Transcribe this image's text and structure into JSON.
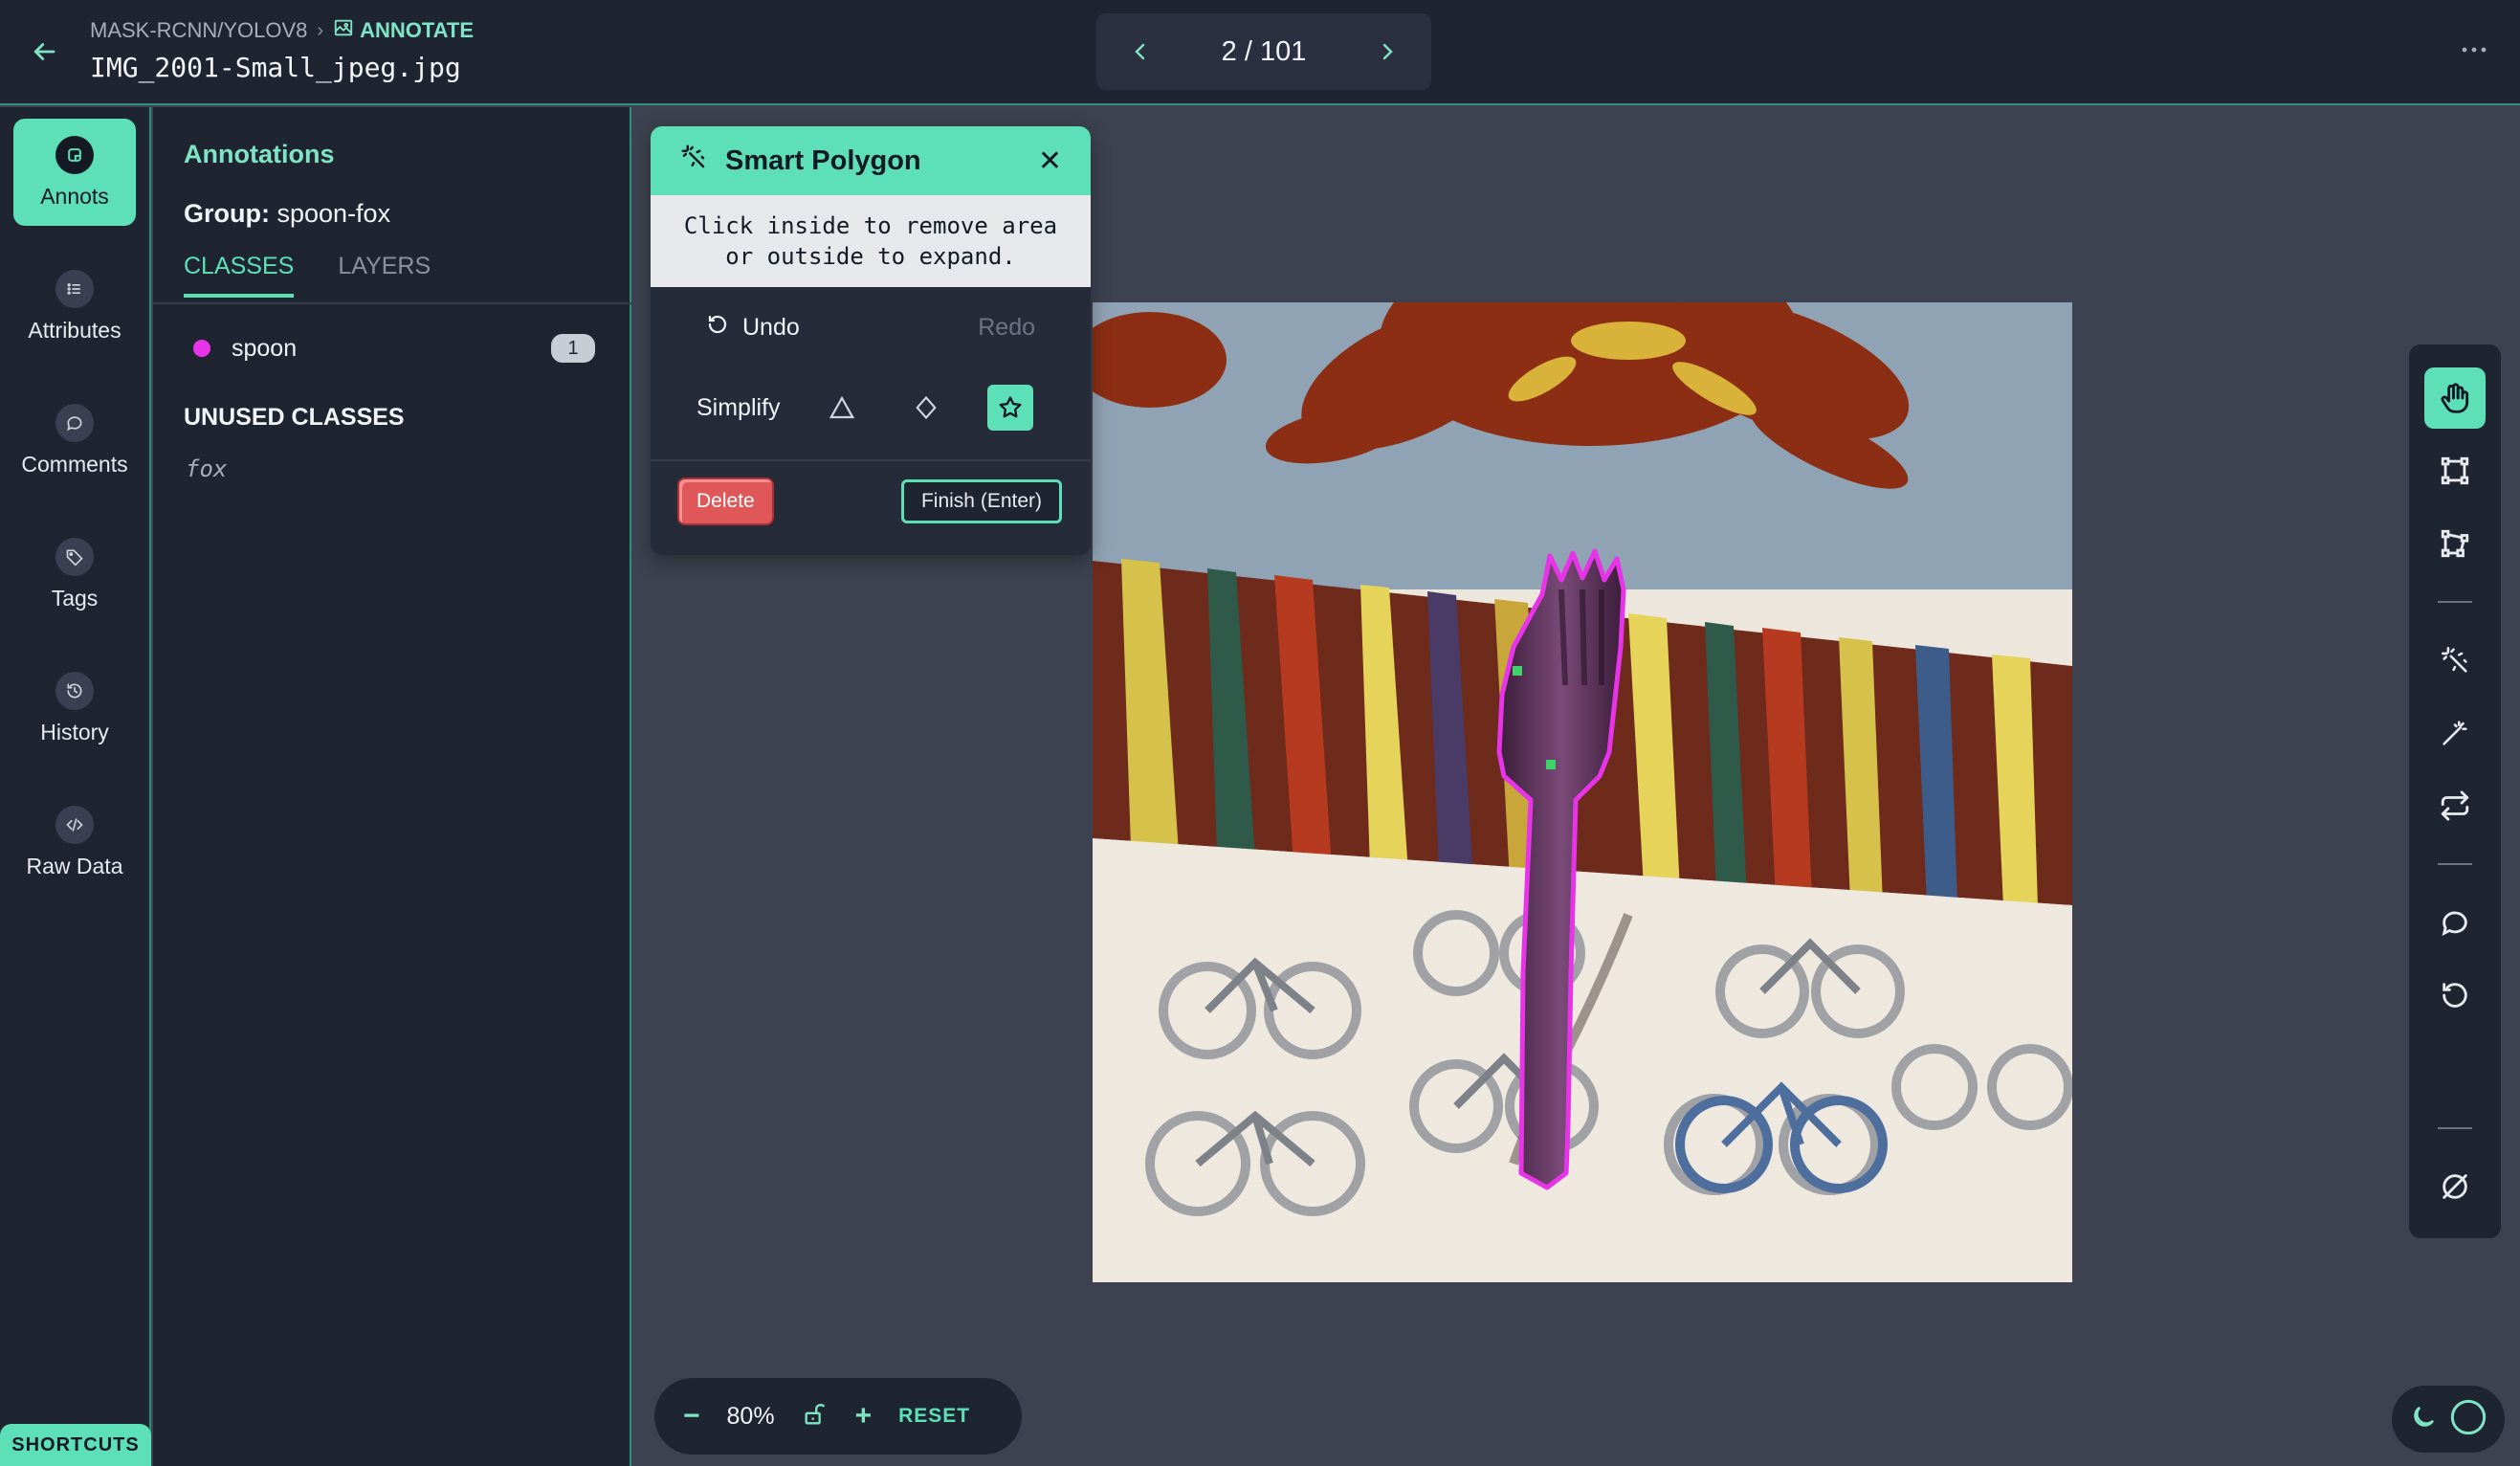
{
  "breadcrumb": {
    "project": "MASK-RCNN/YOLOV8",
    "current": "ANNOTATE"
  },
  "file": {
    "name": "IMG_2001-Small_jpeg.jpg"
  },
  "pager": {
    "label": "2 / 101"
  },
  "rail": {
    "items": [
      {
        "label": "Annots",
        "icon": "annotation-icon"
      },
      {
        "label": "Attributes",
        "icon": "list-icon"
      },
      {
        "label": "Comments",
        "icon": "chat-icon"
      },
      {
        "label": "Tags",
        "icon": "tag-icon"
      },
      {
        "label": "History",
        "icon": "history-icon"
      },
      {
        "label": "Raw Data",
        "icon": "code-icon"
      }
    ],
    "shortcuts": "SHORTCUTS"
  },
  "panel": {
    "title": "Annotations",
    "group_label": "Group:",
    "group_value": "spoon-fox",
    "tabs": [
      "CLASSES",
      "LAYERS"
    ],
    "classes": [
      {
        "name": "spoon",
        "count": "1",
        "color": "#e834e8"
      }
    ],
    "unused_title": "UNUSED CLASSES",
    "unused": [
      "fox"
    ]
  },
  "smart_polygon": {
    "title": "Smart Polygon",
    "hint_line1": "Click inside to remove area",
    "hint_line2": "or outside to expand.",
    "undo": "Undo",
    "redo": "Redo",
    "simplify": "Simplify",
    "delete": "Delete",
    "finish": "Finish (Enter)"
  },
  "zoom": {
    "minus": "−",
    "value": "80%",
    "plus": "+",
    "reset": "RESET"
  },
  "colors": {
    "accent": "#5de0b8",
    "panel_bg": "#1f2431",
    "canvas_bg": "#3d4250",
    "polygon": "#e834e8"
  }
}
